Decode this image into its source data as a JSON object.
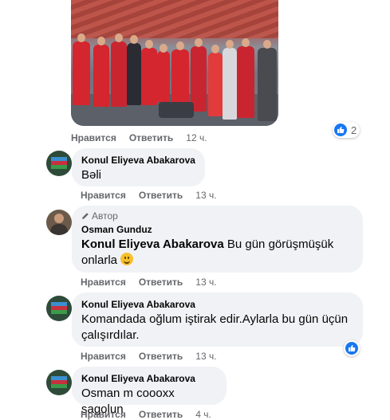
{
  "post_photo": {
    "alt": ""
  },
  "top_actions": {
    "like": "Нравится",
    "reply": "Ответить",
    "time": "12 ч."
  },
  "top_reaction": {
    "count": "2"
  },
  "comments": [
    {
      "author": "Konul Eliyeva Abakarova",
      "text": "Bəli",
      "like": "Нравится",
      "reply": "Ответить",
      "time": "13 ч."
    },
    {
      "badge": "Автор",
      "author": "Osman Gunduz",
      "mention": "Konul Eliyeva Abakarova",
      "text_line1": " Bu gün görüşmüşük",
      "text_line2": "onlarla",
      "like": "Нравится",
      "reply": "Ответить",
      "time": "13 ч."
    },
    {
      "author": "Konul Eliyeva Abakarova",
      "text_line1": "Komandada oğlum iştirak edir.Aylarla bu gün üçün",
      "text_line2": "çalışırdılar.",
      "like": "Нравится",
      "reply": "Ответить",
      "time": "13 ч."
    },
    {
      "author": "Konul Eliyeva Abakarova",
      "text": "Osman m coooxx sagolun",
      "like": "Нравится",
      "reply": "Ответить",
      "time": "4 ч."
    }
  ],
  "colors": {
    "bubble": "#f0f2f5",
    "like_blue": "#1877f2",
    "muted": "#65676b"
  },
  "icons": {
    "reaction": "like-icon",
    "author_badge": "pencil-icon",
    "emoji": "smiling-face-emoji"
  }
}
